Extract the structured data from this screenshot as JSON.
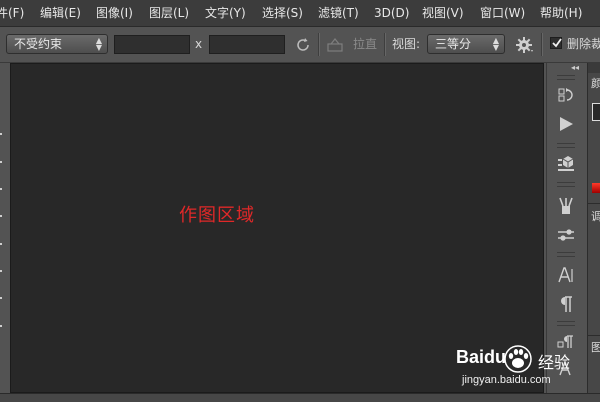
{
  "menu": {
    "items": [
      "件(F)",
      "编辑(E)",
      "图像(I)",
      "图层(L)",
      "文字(Y)",
      "选择(S)",
      "滤镜(T)",
      "3D(D)",
      "视图(V)",
      "窗口(W)",
      "帮助(H)"
    ]
  },
  "options": {
    "style_select": "不受约束",
    "x_separator": "x",
    "straighten_label": "拉直",
    "view_label": "视图:",
    "view_select": "三等分",
    "delete_label": "删除裁"
  },
  "canvas": {
    "label": "作图区域",
    "label_color": "#e02828"
  },
  "right_tools": [
    "history-icon",
    "play-action-icon",
    "3d-cube-icon",
    "brush-presets-icon",
    "adjustments-sliders-icon",
    "character-icon",
    "paragraph-icon",
    "paragraph-styles-icon"
  ],
  "far_panel": {
    "chars": [
      "颜",
      "调",
      "图"
    ]
  },
  "watermark": {
    "brand": "Baidu",
    "text": "经验",
    "url": "jingyan.baidu.com"
  }
}
